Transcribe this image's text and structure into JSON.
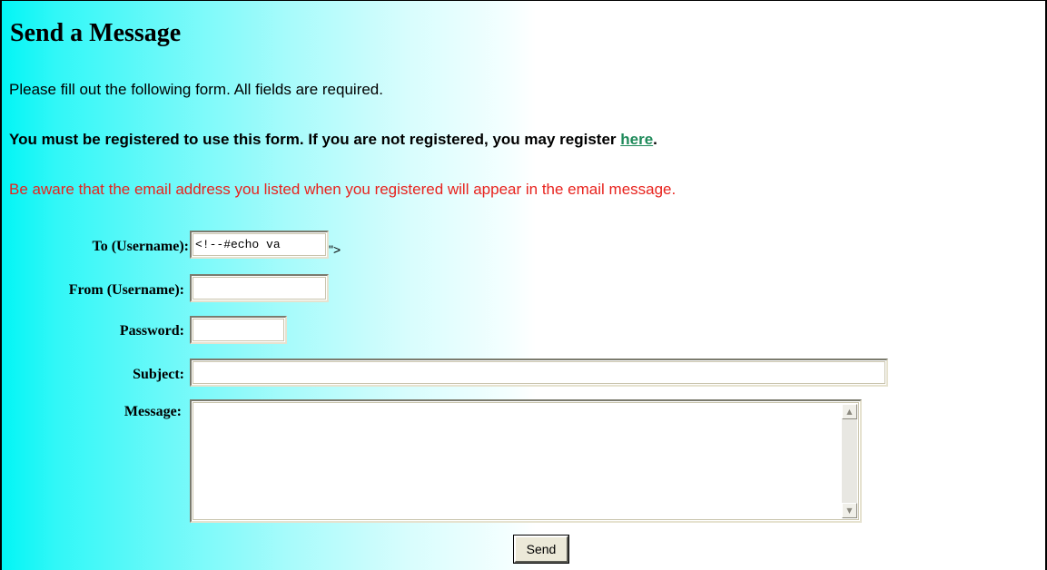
{
  "page": {
    "title": "Send a Message",
    "intro": "Please fill out the following form. All fields are required.",
    "notice": {
      "text": "You must be registered to use this form. If you are not registered, you may register ",
      "link_label": "here",
      "trailing": "."
    },
    "warning": "Be aware that the email address you listed when you registered will appear in the email message."
  },
  "form": {
    "to": {
      "label": "To (Username):",
      "value": "<!--#echo va",
      "suffix": "\">"
    },
    "from": {
      "label": "From (Username):",
      "value": ""
    },
    "password": {
      "label": "Password:",
      "value": ""
    },
    "subject": {
      "label": "Subject:",
      "value": ""
    },
    "message": {
      "label": "Message:",
      "value": ""
    },
    "send_label": "Send"
  },
  "icons": {
    "scroll_up": "scroll-up-arrow-icon",
    "scroll_down": "scroll-down-arrow-icon"
  },
  "colors": {
    "link": "#1f8a5a",
    "warning": "#e8231e",
    "gradient_start": "#00f5f5"
  }
}
